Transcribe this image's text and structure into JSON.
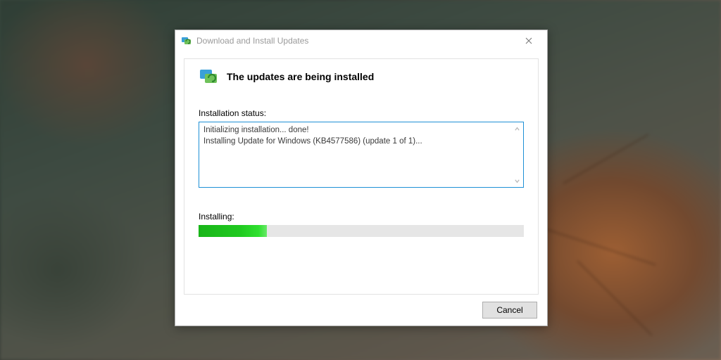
{
  "window": {
    "title": "Download and Install Updates"
  },
  "heading": "The updates are being installed",
  "labels": {
    "installation_status": "Installation status:",
    "installing": "Installing:"
  },
  "status_log": "Initializing installation... done!\nInstalling Update for Windows (KB4577586) (update 1 of 1)...",
  "progress": {
    "percent": 21
  },
  "buttons": {
    "cancel": "Cancel"
  },
  "icons": {
    "update": "update-icon",
    "close": "close-icon"
  }
}
